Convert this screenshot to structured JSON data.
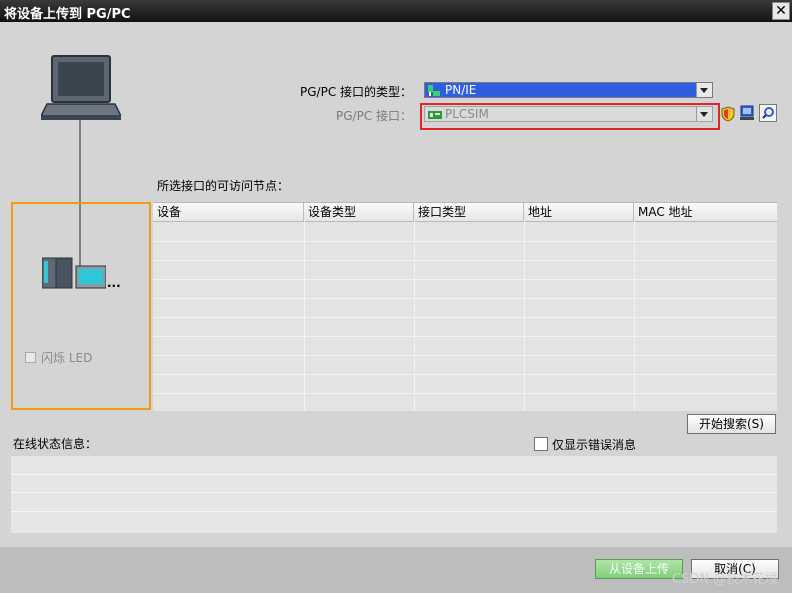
{
  "window": {
    "title": "将设备上传到 PG/PC",
    "close_label": "✕"
  },
  "interface": {
    "type_label": "PG/PC 接口的类型：",
    "type_value": "PN/IE",
    "interface_label": "PG/PC 接口：",
    "interface_value": "PLCSIM"
  },
  "nodes": {
    "section_label": "所选接口的可访问节点：",
    "columns": [
      "设备",
      "设备类型",
      "接口类型",
      "地址",
      "MAC 地址"
    ]
  },
  "device_panel": {
    "flash_led_label": "闪烁 LED",
    "dots": "..."
  },
  "search": {
    "start_label": "开始搜索(S)"
  },
  "status": {
    "label": "在线状态信息：",
    "errors_only_label": "仅显示错误消息"
  },
  "footer": {
    "upload_label": "从设备上传",
    "cancel_label": "取消(C)"
  },
  "watermark": "CSDN @技术花境",
  "colors": {
    "highlight_red": "#e0262b",
    "highlight_orange": "#f39c12",
    "selection_blue": "#2f5fe0"
  }
}
